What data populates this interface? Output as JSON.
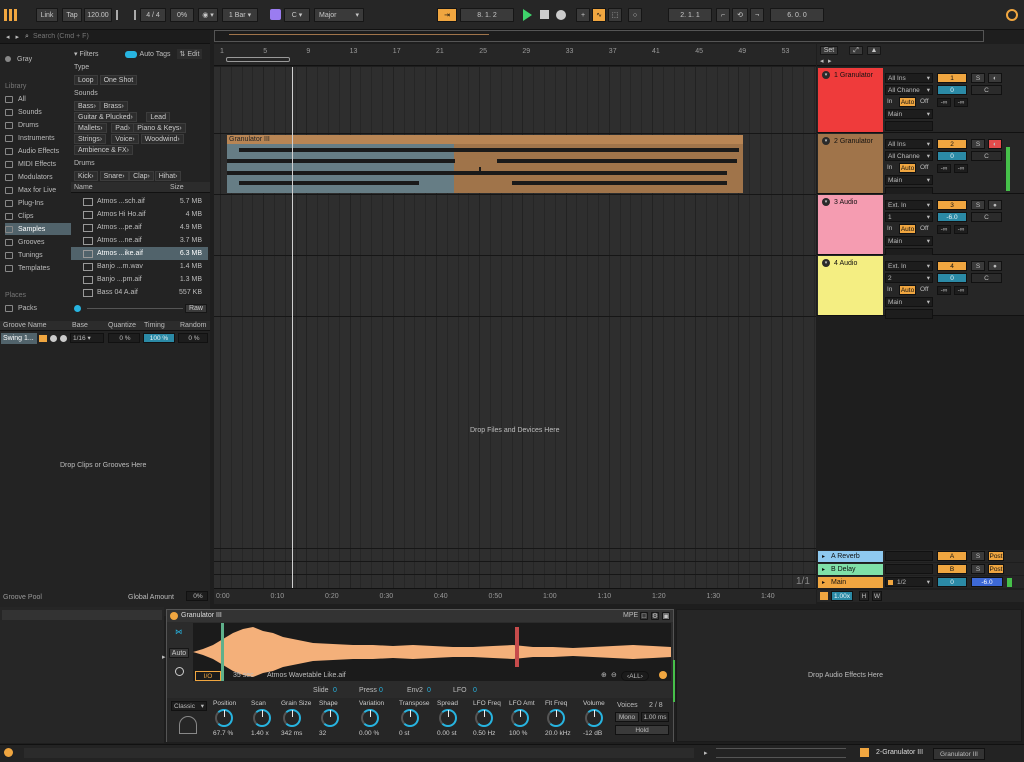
{
  "transport": {
    "link": "Link",
    "tap": "Tap",
    "tempo": "120.00",
    "signature": "4 / 4",
    "swing": "0%",
    "quantize": "1 Bar",
    "key": "C",
    "scale": "Major",
    "position": "8.  1.  2",
    "loop_start": "2.  1.  1",
    "loop_length": "6.  0.  0"
  },
  "browser": {
    "search_placeholder": "Search (Cmd + F)",
    "collection": "Gray",
    "library_header": "Library",
    "library_items": [
      "All",
      "Sounds",
      "Drums",
      "Instruments",
      "Audio Effects",
      "MIDI Effects",
      "Modulators",
      "Max for Live",
      "Plug-Ins",
      "Clips",
      "Samples",
      "Grooves",
      "Tunings",
      "Templates"
    ],
    "places_header": "Places",
    "places_items": [
      "Packs"
    ],
    "filters_label": "Filters",
    "auto_tags": "Auto Tags",
    "edit": "Edit",
    "type_label": "Type",
    "type_tags": [
      "Loop",
      "One Shot"
    ],
    "sounds_label": "Sounds",
    "sounds_tags": [
      "Bass",
      "Brass",
      "Guitar & Plucked",
      "Lead",
      "Mallets",
      "Pad",
      "Piano & Keys",
      "Strings",
      "Voice",
      "Woodwind",
      "Ambience & FX"
    ],
    "drums_label": "Drums",
    "drums_tags": [
      "Kick",
      "Snare",
      "Clap",
      "Hihat"
    ],
    "col_name": "Name",
    "col_size": "Size",
    "files": [
      {
        "name": "Atmos ...sch.aif",
        "size": "5.7 MB"
      },
      {
        "name": "Atmos Hi Ho.aif",
        "size": "4 MB"
      },
      {
        "name": "Atmos ...pe.aif",
        "size": "4.9 MB"
      },
      {
        "name": "Atmos ...ne.aif",
        "size": "3.7 MB"
      },
      {
        "name": "Atmos ...ike.aif",
        "size": "6.3 MB"
      },
      {
        "name": "Banjo ...m.wav",
        "size": "1.4 MB"
      },
      {
        "name": "Banjo ...pm.aif",
        "size": "1.3 MB"
      },
      {
        "name": "Bass 04 A.aif",
        "size": "557 KB"
      }
    ],
    "raw": "Raw"
  },
  "groove": {
    "headers": [
      "Groove Name",
      "Base",
      "Quantize",
      "Timing",
      "Random"
    ],
    "row": {
      "name": "Swing 1...",
      "base": "1/16",
      "quantize": "0 %",
      "timing": "100 %",
      "random": "0 %"
    },
    "drop_hint": "Drop Clips or Grooves Here",
    "pool": "Groove Pool",
    "global_amount_label": "Global Amount",
    "global_amount": "0%"
  },
  "arrangement": {
    "bars": [
      "1",
      "5",
      "9",
      "13",
      "17",
      "21",
      "25",
      "29",
      "33",
      "37",
      "41",
      "45",
      "49",
      "53"
    ],
    "time": [
      "0:00",
      "0:10",
      "0:20",
      "0:30",
      "0:40",
      "0:50",
      "1:00",
      "1:10",
      "1:20",
      "1:30",
      "1:40"
    ],
    "clip_name": "Granulator III",
    "drop_hint": "Drop Files and Devices Here",
    "page": "1/1",
    "zoom": "1.00x",
    "set": "Set"
  },
  "tracks": [
    {
      "num": "1",
      "name": "1 Granulator",
      "color": "#ef3b3b",
      "input": "All Ins",
      "channel": "All Channe",
      "vol": "0",
      "pan": "C",
      "out": "Main",
      "monitor": "Auto"
    },
    {
      "num": "2",
      "name": "2 Granulator",
      "color": "#a0744a",
      "input": "All Ins",
      "channel": "All Channe",
      "vol": "0",
      "pan": "C",
      "out": "Main",
      "monitor": "Auto"
    },
    {
      "num": "3",
      "name": "3 Audio",
      "color": "#f59cb1",
      "input": "Ext. In",
      "channel": "1",
      "vol": "-6.0",
      "pan": "C",
      "out": "Main",
      "monitor": "Auto"
    },
    {
      "num": "4",
      "name": "4 Audio",
      "color": "#f4ee82",
      "input": "Ext. In",
      "channel": "2",
      "vol": "0",
      "pan": "C",
      "out": "Main",
      "monitor": "Auto"
    }
  ],
  "mixer_labels": {
    "in": "In",
    "auto": "Auto",
    "off": "Off",
    "inf": "-∞",
    "s": "S",
    "post": "Post",
    "h": "H",
    "w": "W"
  },
  "returns": [
    {
      "name": "A Reverb",
      "letter": "A",
      "color": "#8ec9f0"
    },
    {
      "name": "B Delay",
      "letter": "B",
      "color": "#7fe0a8"
    }
  ],
  "main": {
    "name": "Main",
    "color": "#f0a640",
    "fraction": "1/2",
    "vol": "0",
    "pan": "-6.0"
  },
  "device": {
    "title": "Granulator III",
    "mpe": "MPE",
    "auto": "Auto",
    "io": "I/O",
    "length": "35 sec",
    "sample": "Atmos Wavetable Like.aif",
    "all": "ALL",
    "mod_labels": [
      "Slide",
      "Press",
      "Env2",
      "LFO"
    ],
    "mod_values": [
      "0",
      "0",
      "0",
      "0"
    ],
    "mode": "Classic",
    "knobs": [
      {
        "label": "Position",
        "value": "67.7 %"
      },
      {
        "label": "Scan",
        "value": "1.40 x"
      },
      {
        "label": "Grain Size",
        "value": "342 ms"
      },
      {
        "label": "Shape",
        "value": "32"
      },
      {
        "label": "Variation",
        "value": "0.00 %"
      },
      {
        "label": "Transpose",
        "value": "0 st"
      },
      {
        "label": "Spread",
        "value": "0.00 st"
      },
      {
        "label": "LFO Freq",
        "value": "0.50 Hz"
      },
      {
        "label": "LFO Amt",
        "value": "100 %"
      },
      {
        "label": "Flt Freq",
        "value": "20.0 kHz"
      },
      {
        "label": "Volume",
        "value": "-12 dB"
      }
    ],
    "voices_label": "Voices",
    "voices": "2 / 8",
    "mono": "Mono",
    "glide": "1.00 ms",
    "hold": "Hold",
    "drop_fx": "Drop Audio Effects Here"
  },
  "status": {
    "track": "2-Granulator III",
    "device": "Granulator III"
  }
}
